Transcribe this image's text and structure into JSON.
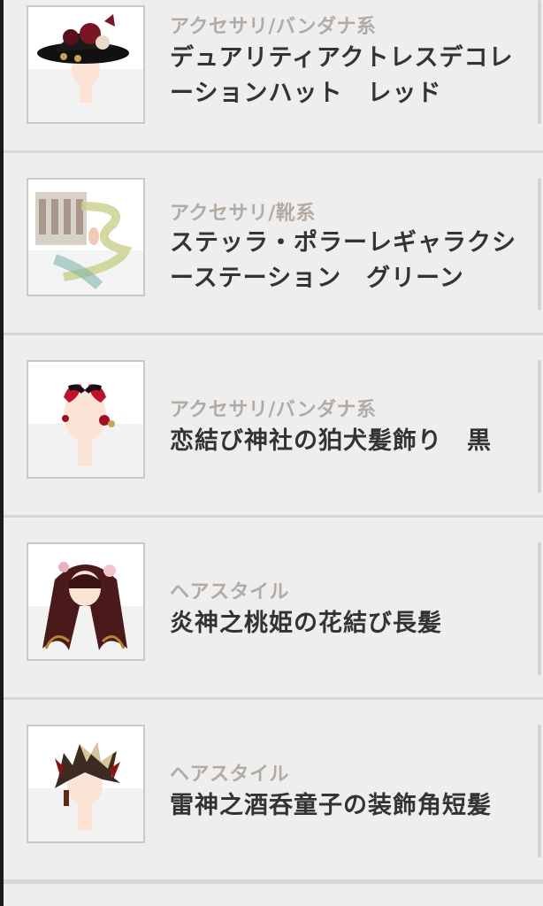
{
  "items": [
    {
      "category": "アクセサリ/バンダナ系",
      "name": "デュアリティアクトレスデコレーションハット　レッド",
      "thumbnail": "hat-icon"
    },
    {
      "category": "アクセサリ/靴系",
      "name": "ステッラ・ポラーレギャラクシーステーション　グリーン",
      "thumbnail": "station-icon"
    },
    {
      "category": "アクセサリ/バンダナ系",
      "name": "恋結び神社の狛犬髪飾り　黒",
      "thumbnail": "hair-ornament-icon"
    },
    {
      "category": "ヘアスタイル",
      "name": "炎神之桃姫の花結び長髪",
      "thumbnail": "long-hair-icon"
    },
    {
      "category": "ヘアスタイル",
      "name": "雷神之酒呑童子の装飾角短髪",
      "thumbnail": "short-hair-icon"
    }
  ]
}
